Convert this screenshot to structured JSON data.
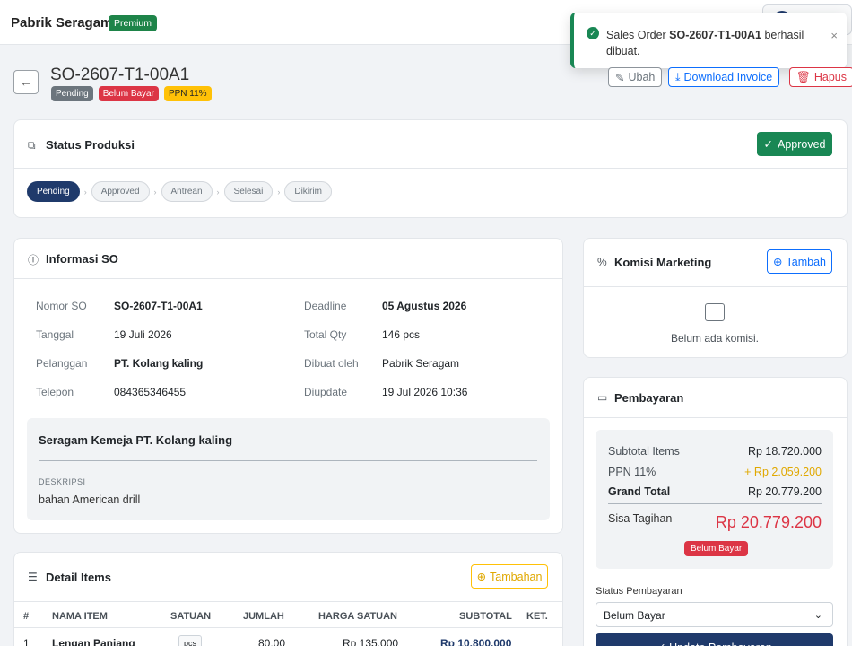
{
  "topbar": {
    "brand": "Pabrik Seragam",
    "plan_badge": "Premium"
  },
  "toast": {
    "prefix": "Sales Order ",
    "so": "SO-2607-T1-00A1",
    "suffix": " berhasil dibuat.",
    "close": "×"
  },
  "header": {
    "back": "←",
    "title": "SO-2607-T1-00A1",
    "tags": [
      "Pending",
      "Belum Bayar",
      "PPN 11%"
    ],
    "edit_label": "Ubah",
    "download_label": "Download Invoice",
    "delete_label": "Hapus"
  },
  "status": {
    "title": "Status Produksi",
    "action_label": "Approved",
    "steps": [
      "Pending",
      "Approved",
      "Antrean",
      "Selesai",
      "Dikirim"
    ],
    "active_step": 0
  },
  "info": {
    "title": "Informasi SO",
    "left": [
      {
        "label": "Nomor SO",
        "value": "SO-2607-T1-00A1"
      },
      {
        "label": "Tanggal",
        "value": "19 Juli 2026"
      },
      {
        "label": "Pelanggan",
        "value": "PT. Kolang kaling"
      },
      {
        "label": "Telepon",
        "value": "084365346455"
      }
    ],
    "right": [
      {
        "label": "Deadline",
        "value": "05 Agustus 2026"
      },
      {
        "label": "Total Qty",
        "value": "146 pcs"
      },
      {
        "label": "Dibuat oleh",
        "value": "Pabrik Seragam"
      },
      {
        "label": "Diupdate",
        "value": "19 Jul 2026 10:36"
      }
    ],
    "desc_title": "Seragam Kemeja PT. Kolang kaling",
    "desc_label": "DESKRIPSI",
    "desc_value": "bahan American drill"
  },
  "items": {
    "title": "Detail Items",
    "add_label": "Tambahan",
    "columns": [
      "#",
      "NAMA ITEM",
      "SATUAN",
      "JUMLAH",
      "HARGA SATUAN",
      "SUBTOTAL",
      "KET."
    ],
    "rows": [
      {
        "no": "1",
        "name": "Lengan Panjang",
        "unit": "pcs",
        "qty": "80,00",
        "price": "Rp 135.000",
        "subtotal": "Rp 10.800.000"
      }
    ]
  },
  "komisi": {
    "title": "Komisi Marketing",
    "add_label": "Tambah",
    "empty_text": "Belum ada komisi."
  },
  "payment": {
    "title": "Pembayaran",
    "subtotal_label": "Subtotal Items",
    "subtotal_value": "Rp 18.720.000",
    "ppn_label": "PPN 11%",
    "ppn_value": "+ Rp 2.059.200",
    "total_label": "Grand Total",
    "total_value": "Rp 20.779.200",
    "sisa_label": "Sisa Tagihan",
    "sisa_value": "Rp 20.779.200",
    "badge": "Belum Bayar",
    "status_label": "Status Pembayaran",
    "status_value": "Belum Bayar",
    "update_label": "✓ Update Pembayaran"
  },
  "colors": {
    "primary": "#1f3a6b",
    "success": "#198754",
    "danger": "#dc3545",
    "warning": "#ffc107",
    "blue": "#0d6efd"
  }
}
